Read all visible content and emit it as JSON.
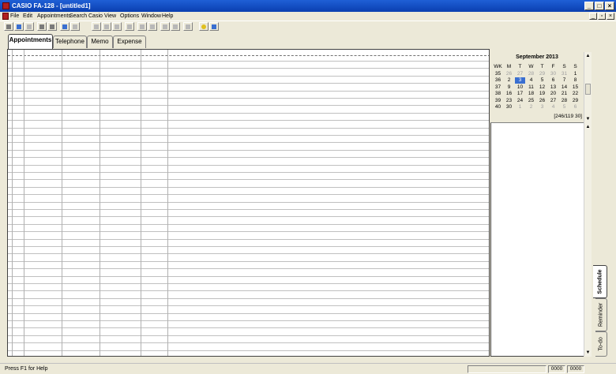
{
  "window": {
    "title": "CASIO FA-128 - [untitled1]",
    "minimize": "_",
    "restore": "□",
    "close": "×"
  },
  "menu": [
    "File",
    "Edit",
    "Appointments",
    "Search",
    "Casio",
    "View",
    "Options",
    "Window",
    "Help"
  ],
  "mdi": {
    "minimize": "_",
    "restore": "▫",
    "close": "×"
  },
  "tabs": [
    "Appointments",
    "Telephone",
    "Memo",
    "Expense"
  ],
  "active_tab": "Appointments",
  "calendar": {
    "title": "September 2013",
    "week_header": "WK",
    "day_headers": [
      "M",
      "T",
      "W",
      "T",
      "F",
      "S",
      "S"
    ],
    "rows": [
      {
        "wk": "35",
        "days": [
          "26",
          "27",
          "28",
          "29",
          "30",
          "31",
          "1"
        ]
      },
      {
        "wk": "36",
        "days": [
          "2",
          "3",
          "4",
          "5",
          "6",
          "7",
          "8"
        ]
      },
      {
        "wk": "37",
        "days": [
          "9",
          "10",
          "11",
          "12",
          "13",
          "14",
          "15"
        ]
      },
      {
        "wk": "38",
        "days": [
          "16",
          "17",
          "18",
          "19",
          "20",
          "21",
          "22"
        ]
      },
      {
        "wk": "39",
        "days": [
          "23",
          "24",
          "25",
          "26",
          "27",
          "28",
          "29"
        ]
      },
      {
        "wk": "40",
        "days": [
          "30",
          "1",
          "2",
          "3",
          "4",
          "5",
          "6"
        ]
      }
    ],
    "selected_day": "3",
    "footer": "[246/119 30]"
  },
  "side_tabs": [
    "Schedule",
    "Reminder",
    "To-do"
  ],
  "active_side_tab": "Schedule",
  "status": {
    "text": "Press F1 for Help",
    "panel1": "0000",
    "panel2": "0000"
  },
  "scroll_arrows": {
    "up": "▲",
    "down": "▼"
  }
}
